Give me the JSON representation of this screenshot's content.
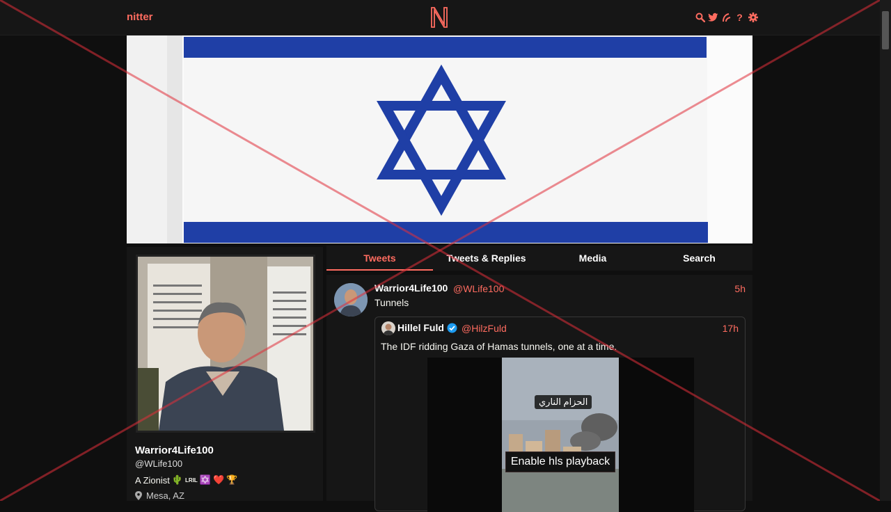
{
  "navbar": {
    "logo_text": "nitter",
    "icons": [
      "search-icon",
      "twitter-icon",
      "rss-icon",
      "help-icon",
      "settings-icon"
    ],
    "help_glyph": "?"
  },
  "profile": {
    "name": "Warrior4Life100",
    "handle": "@WLife100",
    "bio": "A Zionist",
    "bio_emoji": [
      "🌵",
      "LRIL",
      "✡️",
      "❤️",
      "🏆"
    ],
    "location": "Mesa, AZ"
  },
  "tabs": [
    {
      "label": "Tweets",
      "active": true
    },
    {
      "label": "Tweets & Replies",
      "active": false
    },
    {
      "label": "Media",
      "active": false
    },
    {
      "label": "Search",
      "active": false
    }
  ],
  "tweet": {
    "author_name": "Warrior4Life100",
    "author_handle": "@WLife100",
    "time": "5h",
    "text": "Tunnels",
    "quote": {
      "author_name": "Hillel Fuld",
      "author_handle": "@HilzFuld",
      "verified": true,
      "time": "17h",
      "text": "The IDF ridding Gaza of Hamas tunnels, one at a time.",
      "video_caption": "الحزام الناري",
      "hls_button_label": "Enable hls playback"
    }
  },
  "colors": {
    "accent": "#ff6c60",
    "background": "#0f0f0f",
    "panel": "#161616",
    "flag_blue": "#1f3fa6",
    "overlay_red": "#e0303a"
  }
}
